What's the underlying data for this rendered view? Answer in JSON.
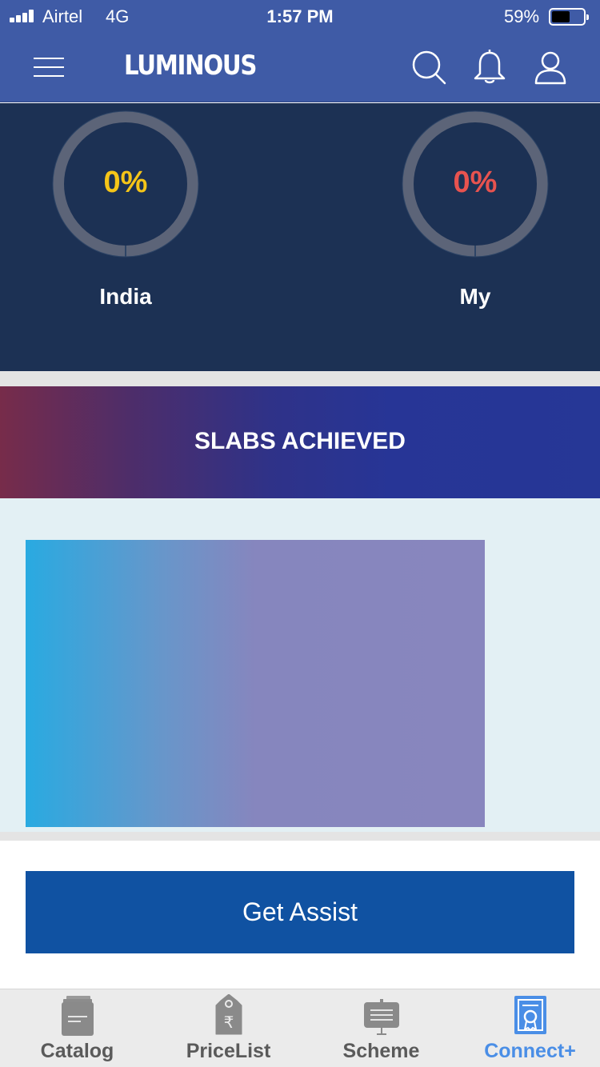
{
  "status_bar": {
    "carrier": "Airtel",
    "network": "4G",
    "time": "1:57 PM",
    "battery_percent": "59%",
    "battery_level": 0.59
  },
  "header": {
    "logo_text": "LUMINOUS",
    "icons": [
      "menu-icon",
      "search-icon",
      "bell-icon",
      "user-icon"
    ]
  },
  "stats": [
    {
      "value": "0%",
      "label": "India",
      "color": "#f5c518",
      "progress": 0
    },
    {
      "value": "0%",
      "label": "My",
      "color": "#e8534f",
      "progress": 0
    }
  ],
  "slabs": {
    "title": "SLABS ACHIEVED"
  },
  "assist": {
    "label": "Get Assist"
  },
  "tabs": [
    {
      "label": "Catalog",
      "icon": "catalog-icon",
      "active": false
    },
    {
      "label": "PriceList",
      "icon": "price-tag-icon",
      "active": false
    },
    {
      "label": "Scheme",
      "icon": "scheme-board-icon",
      "active": false
    },
    {
      "label": "Connect+",
      "icon": "certificate-icon",
      "active": true
    }
  ],
  "colors": {
    "header_bg": "#3f5ba6",
    "dashboard_bg": "#1c3154",
    "assist_button": "#1052a2",
    "active_tab": "#4a8ee6",
    "inactive_tab": "#5a5a5a"
  }
}
